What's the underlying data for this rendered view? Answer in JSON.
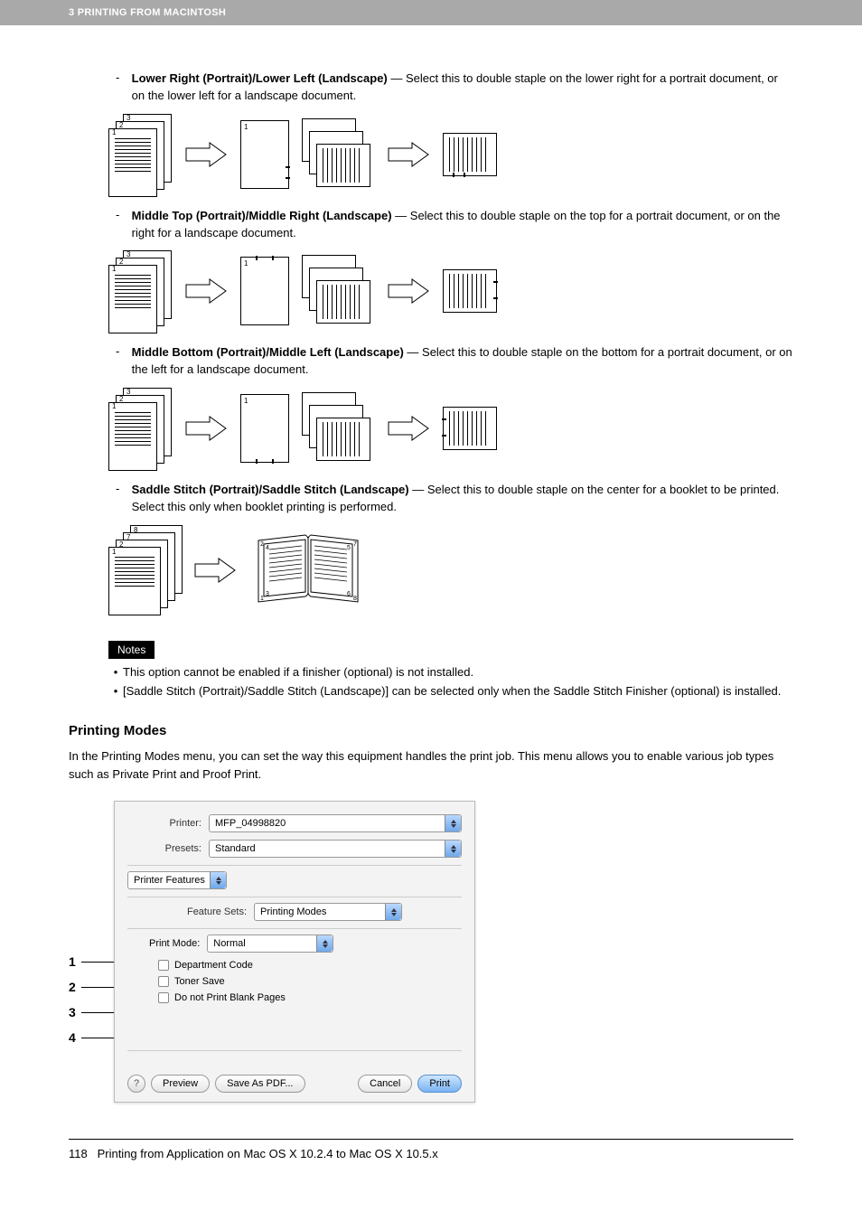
{
  "header": {
    "breadcrumb": "3 PRINTING FROM MACINTOSH"
  },
  "options": [
    {
      "title": "Lower Right (Portrait)/Lower Left (Landscape)",
      "description": " — Select this to double staple on the lower right for a portrait document, or on the lower left for a landscape document."
    },
    {
      "title": "Middle Top (Portrait)/Middle Right (Landscape)",
      "description": " — Select this to double staple on the top for a portrait document, or on the right for a landscape document."
    },
    {
      "title": "Middle Bottom (Portrait)/Middle Left (Landscape)",
      "description": " — Select this to double staple on the bottom for a portrait document, or on the left for a landscape document."
    },
    {
      "title": "Saddle Stitch (Portrait)/Saddle Stitch (Landscape)",
      "description": " — Select this to double staple on the center for a booklet to be printed.  Select this only when booklet printing is performed."
    }
  ],
  "notes_label": "Notes",
  "notes": [
    "This option cannot be enabled if a finisher (optional) is not installed.",
    "[Saddle Stitch (Portrait)/Saddle Stitch (Landscape)] can be selected only when the Saddle Stitch Finisher (optional) is installed."
  ],
  "section": {
    "title": "Printing Modes",
    "description": "In the Printing Modes menu, you can set the way this equipment handles the print job.  This menu allows you to enable various job types such as Private Print and Proof Print."
  },
  "dialog": {
    "printer_label": "Printer:",
    "printer_value": "MFP_04998820",
    "presets_label": "Presets:",
    "presets_value": "Standard",
    "tab_value": "Printer Features",
    "feature_sets_label": "Feature Sets:",
    "feature_sets_value": "Printing Modes",
    "print_mode_label": "Print Mode:",
    "print_mode_value": "Normal",
    "department_code": "Department Code",
    "toner_save": "Toner Save",
    "no_blank": "Do not Print Blank Pages",
    "buttons": {
      "preview": "Preview",
      "save_pdf": "Save As PDF...",
      "cancel": "Cancel",
      "print": "Print"
    }
  },
  "callouts": [
    "1",
    "2",
    "3",
    "4"
  ],
  "footer": {
    "page_number": "118",
    "text": "Printing from Application on Mac OS X 10.2.4 to Mac OS X 10.5.x"
  }
}
